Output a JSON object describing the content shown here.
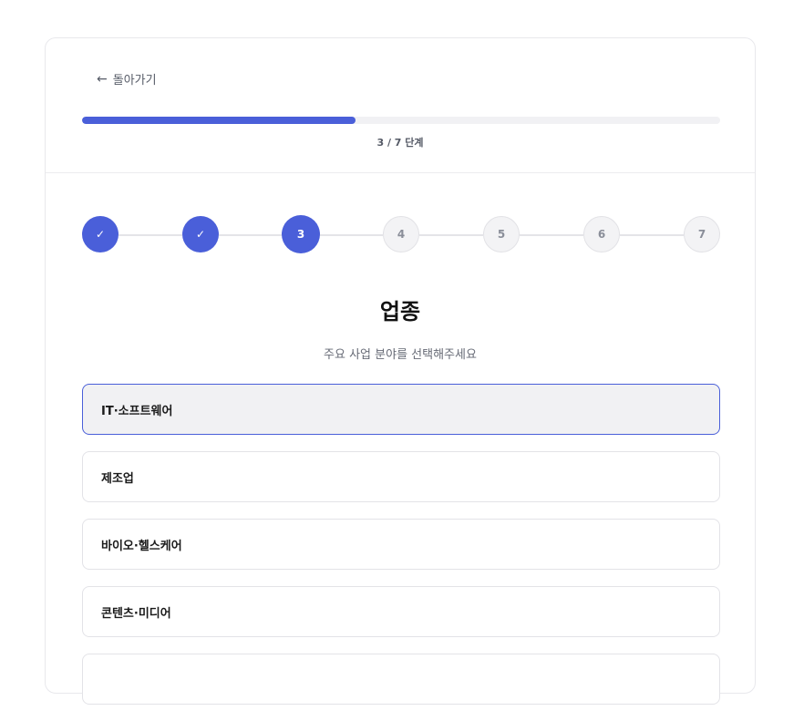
{
  "nav": {
    "back_arrow": "←",
    "back_label": "돌아가기"
  },
  "progress": {
    "current": 3,
    "total": 7,
    "fraction": 0.4286,
    "text": "3 / 7 단계"
  },
  "steps": [
    {
      "label": "✓",
      "state": "done"
    },
    {
      "label": "✓",
      "state": "done"
    },
    {
      "label": "3",
      "state": "current"
    },
    {
      "label": "4",
      "state": "todo"
    },
    {
      "label": "5",
      "state": "todo"
    },
    {
      "label": "6",
      "state": "todo"
    },
    {
      "label": "7",
      "state": "todo"
    }
  ],
  "question": {
    "title": "업종",
    "subtitle": "주요 사업 분야를 선택해주세요"
  },
  "options": [
    {
      "label": "IT·소프트웨어",
      "selected": true
    },
    {
      "label": "제조업",
      "selected": false
    },
    {
      "label": "바이오·헬스케어",
      "selected": false
    },
    {
      "label": "콘텐츠·미디어",
      "selected": false
    },
    {
      "label": "",
      "selected": false
    }
  ],
  "colors": {
    "accent": "#4a5fd9",
    "track": "#f1f1f4",
    "selected_bg": "#f1f1f3"
  }
}
